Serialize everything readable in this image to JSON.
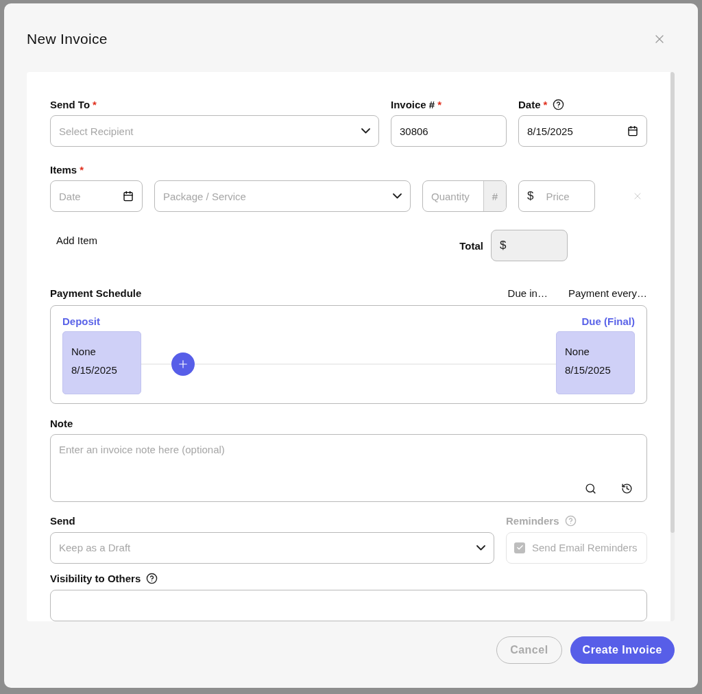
{
  "dialog": {
    "title": "New Invoice"
  },
  "send_to": {
    "label": "Send To",
    "required_mark": "*",
    "placeholder": "Select Recipient"
  },
  "invoice_number": {
    "label": "Invoice #",
    "required_mark": "*",
    "value": "30806"
  },
  "date": {
    "label": "Date",
    "required_mark": "*",
    "value": "8/15/2025"
  },
  "items": {
    "label": "Items",
    "required_mark": "*",
    "rows": [
      {
        "date_placeholder": "Date",
        "service_placeholder": "Package / Service",
        "quantity_placeholder": "Quantity",
        "quantity_addon": "#",
        "price_prefix": "$",
        "price_placeholder": "Price"
      }
    ],
    "add_label": "Add Item",
    "total_label": "Total",
    "total_prefix": "$"
  },
  "payment_schedule": {
    "label": "Payment Schedule",
    "options": [
      "Due in…",
      "Payment every…"
    ],
    "milestones": [
      {
        "label": "Deposit",
        "amount": "None",
        "date": "8/15/2025"
      },
      {
        "label": "Due (Final)",
        "amount": "None",
        "date": "8/15/2025"
      }
    ]
  },
  "note": {
    "label": "Note",
    "placeholder": "Enter an invoice note here (optional)"
  },
  "send": {
    "label": "Send",
    "placeholder": "Keep as a Draft"
  },
  "reminders": {
    "label": "Reminders",
    "disabled": true,
    "checkbox": {
      "label": "Send Email Reminders",
      "checked": true
    }
  },
  "visibility": {
    "label": "Visibility to Others"
  },
  "buttons": [
    {
      "label": "Cancel",
      "kind": "secondary"
    },
    {
      "label": "Create Invoice",
      "kind": "primary"
    }
  ]
}
